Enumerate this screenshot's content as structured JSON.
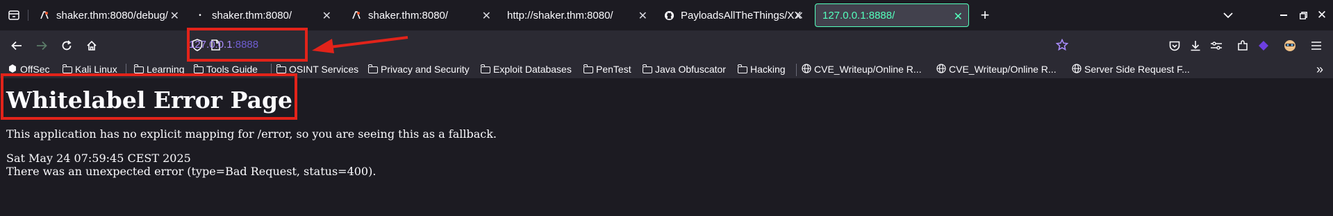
{
  "tabs": [
    {
      "label": "shaker.thm:8080/debug/",
      "icon": "burp-icon"
    },
    {
      "label": "shaker.thm:8080/",
      "icon": "dot-icon"
    },
    {
      "label": "shaker.thm:8080/",
      "icon": "burp-icon"
    },
    {
      "label": "http://shaker.thm:8080/",
      "icon": ""
    },
    {
      "label": "PayloadsAllTheThings/XX",
      "icon": "github-icon"
    },
    {
      "label": "127.0.0.1:8888/",
      "icon": "",
      "active": true
    }
  ],
  "address_bar": {
    "host": "127.0.0.1",
    "port": ":8888"
  },
  "bookmarks": [
    {
      "label": "OffSec",
      "icon": "offsec-icon"
    },
    {
      "label": "Kali Linux",
      "icon": "folder-icon"
    },
    {
      "label": "Learning",
      "icon": "folder-icon"
    },
    {
      "label": "Tools Guide",
      "icon": "folder-icon"
    },
    {
      "label": "OSINT Services",
      "icon": "folder-icon"
    },
    {
      "label": "Privacy and Security",
      "icon": "folder-icon"
    },
    {
      "label": "Exploit Databases",
      "icon": "folder-icon"
    },
    {
      "label": "PenTest",
      "icon": "folder-icon"
    },
    {
      "label": "Java Obfuscator",
      "icon": "folder-icon"
    },
    {
      "label": "Hacking",
      "icon": "folder-icon"
    },
    {
      "label": "CVE_Writeup/Online R...",
      "icon": "globe-icon"
    },
    {
      "label": "CVE_Writeup/Online R...",
      "icon": "globe-icon"
    },
    {
      "label": "Server Side Request F...",
      "icon": "globe-icon"
    }
  ],
  "page": {
    "title": "Whitelabel Error Page",
    "message": "This application has no explicit mapping for /error, so you are seeing this as a fallback.",
    "timestamp": "Sat May 24 07:59:45 CEST 2025",
    "error": "There was an unexpected error (type=Bad Request, status=400)."
  },
  "colors": {
    "annotation": "#e2231a",
    "active_tab": "#54ffbd",
    "url_host": "#a88bfa"
  }
}
